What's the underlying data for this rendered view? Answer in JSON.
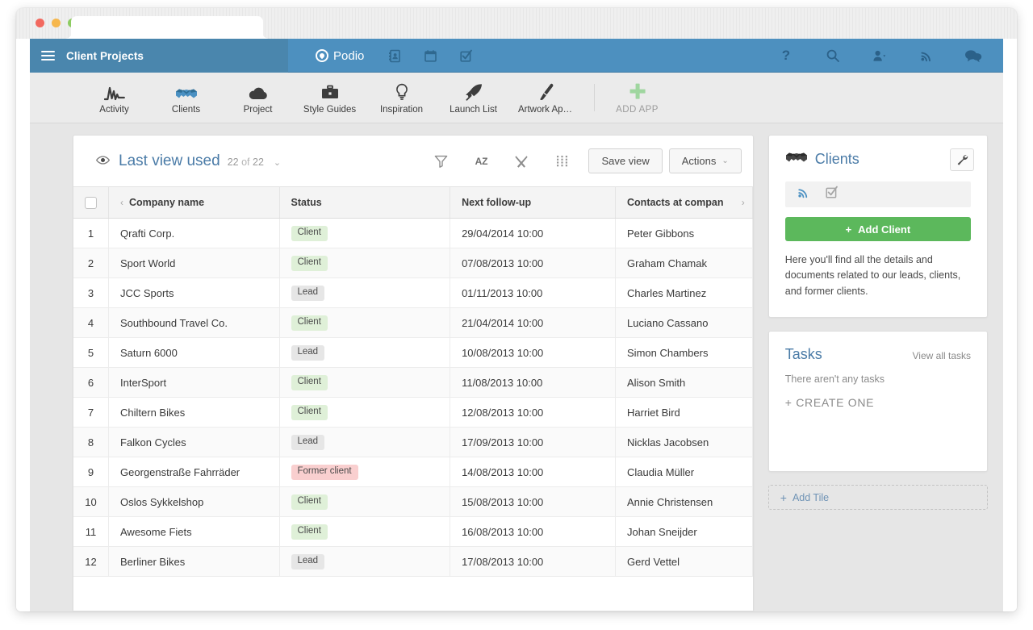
{
  "window": {
    "traffic_lights": [
      "close",
      "minimize",
      "zoom"
    ],
    "tab_label": ""
  },
  "appbar": {
    "menu_icon": "hamburger-icon",
    "title": "Client Projects",
    "brand": "Podio",
    "brand_icon": "podio-logo-icon",
    "center_icons": [
      {
        "name": "contacts-icon",
        "glyph": "▤"
      },
      {
        "name": "calendar-icon",
        "glyph": "▥"
      },
      {
        "name": "tasks-check-icon",
        "glyph": "☑"
      }
    ],
    "right_icons": [
      {
        "name": "help-icon",
        "glyph": "?"
      },
      {
        "name": "search-icon",
        "glyph": "search"
      },
      {
        "name": "user-menu-icon",
        "glyph": "person"
      },
      {
        "name": "activity-stream-icon",
        "glyph": "signal"
      },
      {
        "name": "chat-icon",
        "glyph": "chat"
      }
    ]
  },
  "appnav": {
    "items": [
      {
        "label": "Activity",
        "icon": "activity-chart-icon"
      },
      {
        "label": "Clients",
        "icon": "handshake-icon"
      },
      {
        "label": "Project",
        "icon": "cloud-upload-icon"
      },
      {
        "label": "Style Guides",
        "icon": "briefcase-icon"
      },
      {
        "label": "Inspiration",
        "icon": "lightbulb-icon"
      },
      {
        "label": "Launch List",
        "icon": "rocket-icon"
      },
      {
        "label": "Artwork Ap…",
        "icon": "paintbrush-icon"
      }
    ],
    "add_app": {
      "label": "ADD APP",
      "icon": "plus-icon"
    }
  },
  "view": {
    "eye_icon": "eye-icon",
    "name": "Last view used",
    "count": "22",
    "of": "of",
    "total": "22",
    "caret": "⌄",
    "toolbar_icons": [
      {
        "name": "filter-icon",
        "glyph": "filter"
      },
      {
        "name": "sort-az-icon",
        "glyph": "AZ"
      },
      {
        "name": "tools-icon",
        "glyph": "tools"
      },
      {
        "name": "grid-layout-icon",
        "glyph": "grid"
      }
    ],
    "save_view_label": "Save view",
    "actions_label": "Actions",
    "actions_caret": "⌄"
  },
  "table": {
    "columns": [
      {
        "key": "num",
        "label": ""
      },
      {
        "key": "company",
        "label": "Company name"
      },
      {
        "key": "status",
        "label": "Status"
      },
      {
        "key": "followup",
        "label": "Next follow-up"
      },
      {
        "key": "contact",
        "label": "Contacts at compan"
      }
    ],
    "header_arrow_left": "‹",
    "header_arrow_right": "›",
    "rows": [
      {
        "num": "1",
        "company": "Qrafti Corp.",
        "status": "Client",
        "status_type": "client",
        "followup": "29/04/2014 10:00",
        "contact": "Peter Gibbons"
      },
      {
        "num": "2",
        "company": "Sport World",
        "status": "Client",
        "status_type": "client",
        "followup": "07/08/2013 10:00",
        "contact": "Graham Chamak"
      },
      {
        "num": "3",
        "company": "JCC Sports",
        "status": "Lead",
        "status_type": "lead",
        "followup": "01/11/2013 10:00",
        "contact": "Charles Martinez"
      },
      {
        "num": "4",
        "company": "Southbound Travel Co.",
        "status": "Client",
        "status_type": "client",
        "followup": "21/04/2014 10:00",
        "contact": "Luciano Cassano"
      },
      {
        "num": "5",
        "company": "Saturn 6000",
        "status": "Lead",
        "status_type": "lead",
        "followup": "10/08/2013 10:00",
        "contact": "Simon Chambers"
      },
      {
        "num": "6",
        "company": "InterSport",
        "status": "Client",
        "status_type": "client",
        "followup": "11/08/2013 10:00",
        "contact": "Alison Smith"
      },
      {
        "num": "7",
        "company": "Chiltern Bikes",
        "status": "Client",
        "status_type": "client",
        "followup": "12/08/2013 10:00",
        "contact": "Harriet Bird"
      },
      {
        "num": "8",
        "company": "Falkon Cycles",
        "status": "Lead",
        "status_type": "lead",
        "followup": "17/09/2013 10:00",
        "contact": "Nicklas Jacobsen"
      },
      {
        "num": "9",
        "company": "Georgenstraße Fahrräder",
        "status": "Former client",
        "status_type": "former",
        "followup": "14/08/2013 10:00",
        "contact": "Claudia Müller"
      },
      {
        "num": "10",
        "company": "Oslos Sykkelshop",
        "status": "Client",
        "status_type": "client",
        "followup": "15/08/2013 10:00",
        "contact": "Annie Christensen"
      },
      {
        "num": "11",
        "company": "Awesome Fiets",
        "status": "Client",
        "status_type": "client",
        "followup": "16/08/2013 10:00",
        "contact": "Johan Sneijder"
      },
      {
        "num": "12",
        "company": "Berliner Bikes",
        "status": "Lead",
        "status_type": "lead",
        "followup": "17/08/2013 10:00",
        "contact": "Gerd Vettel"
      }
    ]
  },
  "sidebar": {
    "clients_tile": {
      "icon": "handshake-icon",
      "title": "Clients",
      "wrench_icon": "wrench-icon",
      "toolbar_icons": [
        {
          "name": "activity-stream-icon"
        },
        {
          "name": "tasks-check-icon"
        }
      ],
      "add_button": {
        "plus": "+",
        "label": "Add Client"
      },
      "description": "Here you'll find all the details and documents related to our leads, clients, and former clients."
    },
    "tasks_tile": {
      "title": "Tasks",
      "view_all_label": "View all tasks",
      "empty_text": "There aren't any tasks",
      "create_label": "+ CREATE ONE"
    },
    "add_tile": {
      "plus": "+",
      "label": "Add Tile"
    }
  },
  "colors": {
    "appbar_blue": "#4d90bf",
    "appbar_blue_dark": "#4a86ad",
    "accent_link": "#4a7ba7",
    "green_button": "#5cb85c",
    "badge_client": "#dff0d8",
    "badge_lead": "#e6e6e6",
    "badge_former": "#f9cfcf",
    "page_bg": "#e6e6e6"
  }
}
